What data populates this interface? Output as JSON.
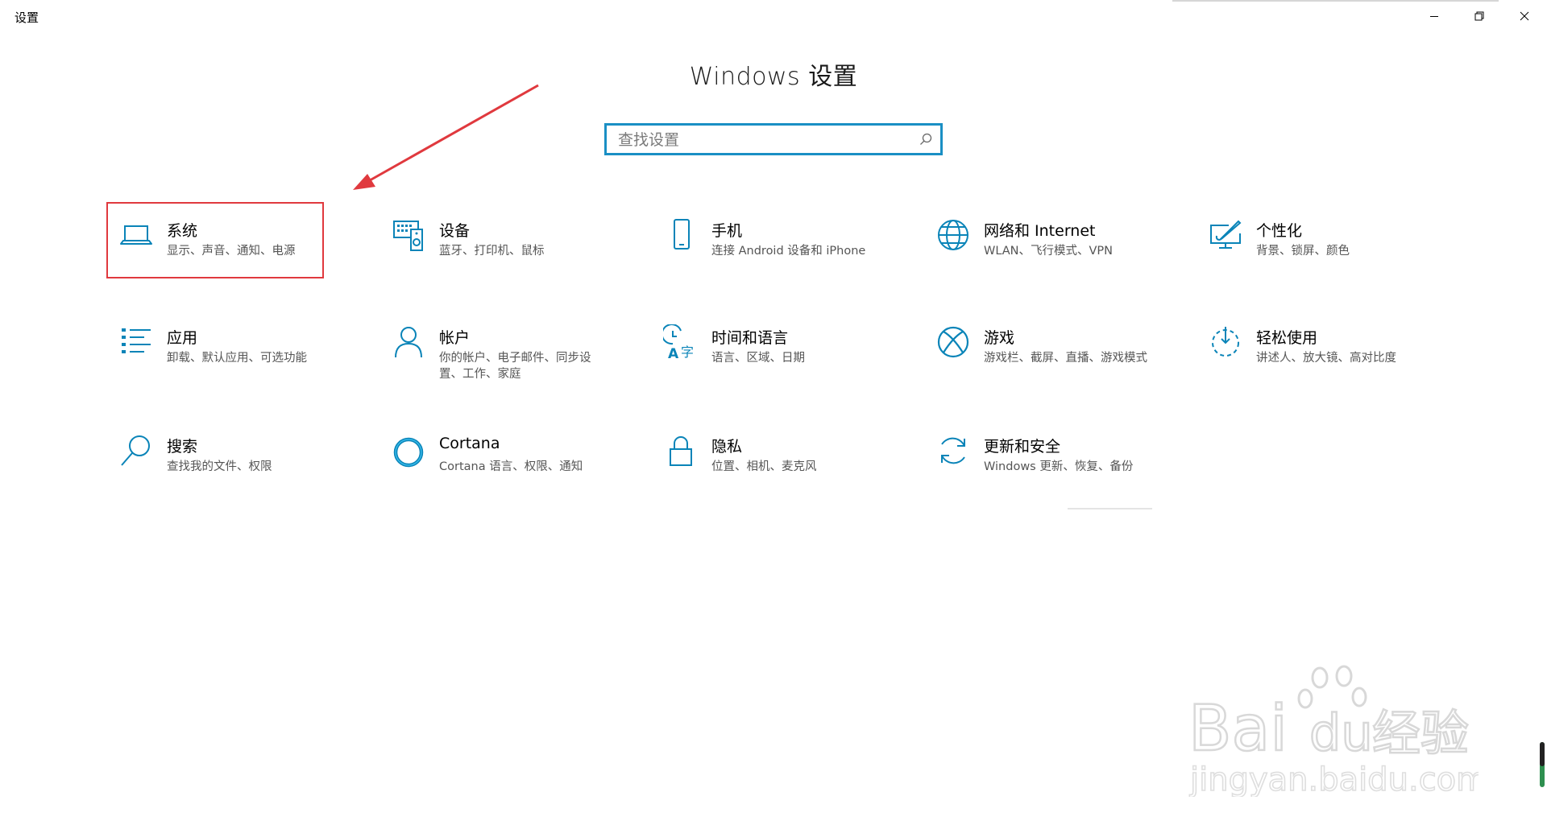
{
  "window": {
    "title": "设置"
  },
  "page": {
    "title": "Windows 设置"
  },
  "search": {
    "placeholder": "查找设置"
  },
  "tiles": [
    {
      "icon": "laptop-icon",
      "title": "系统",
      "desc": "显示、声音、通知、电源"
    },
    {
      "icon": "keyboard-speaker-icon",
      "title": "设备",
      "desc": "蓝牙、打印机、鼠标"
    },
    {
      "icon": "phone-icon",
      "title": "手机",
      "desc": "连接 Android 设备和 iPhone"
    },
    {
      "icon": "globe-icon",
      "title": "网络和 Internet",
      "desc": "WLAN、飞行模式、VPN"
    },
    {
      "icon": "paint-monitor-icon",
      "title": "个性化",
      "desc": "背景、锁屏、颜色"
    },
    {
      "icon": "apps-list-icon",
      "title": "应用",
      "desc": "卸载、默认应用、可选功能"
    },
    {
      "icon": "person-icon",
      "title": "帐户",
      "desc": "你的帐户、电子邮件、同步设置、工作、家庭"
    },
    {
      "icon": "time-language-icon",
      "title": "时间和语言",
      "desc": "语言、区域、日期"
    },
    {
      "icon": "xbox-icon",
      "title": "游戏",
      "desc": "游戏栏、截屏、直播、游戏模式"
    },
    {
      "icon": "ease-of-access-icon",
      "title": "轻松使用",
      "desc": "讲述人、放大镜、高对比度"
    },
    {
      "icon": "search-icon",
      "title": "搜索",
      "desc": "查找我的文件、权限"
    },
    {
      "icon": "cortana-icon",
      "title": "Cortana",
      "desc": "Cortana 语言、权限、通知"
    },
    {
      "icon": "lock-icon",
      "title": "隐私",
      "desc": "位置、相机、麦克风"
    },
    {
      "icon": "update-icon",
      "title": "更新和安全",
      "desc": "Windows 更新、恢复、备份"
    }
  ],
  "colors": {
    "accent": "#0a84b8",
    "highlight": "#e0393e",
    "search_border": "#1a8fc4"
  }
}
